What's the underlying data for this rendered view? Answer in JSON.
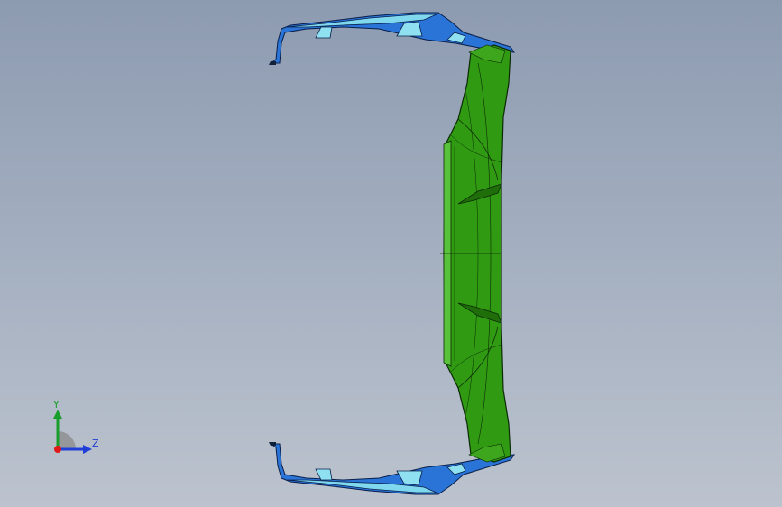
{
  "viewport": {
    "background_top": "#8d9bb1",
    "background_bottom": "#bcc3ce"
  },
  "model": {
    "name": "bumper-part",
    "face_color": "#2f9a12",
    "edge_color": "#0d2a06",
    "bracket_color": "#2a74d8",
    "bracket_highlight": "#7fd8ee"
  },
  "triad": {
    "y_label": "Y",
    "z_label": "Z",
    "y_color": "#1a9e2b",
    "z_color": "#1f3fd6",
    "x_color": "#e01818"
  }
}
